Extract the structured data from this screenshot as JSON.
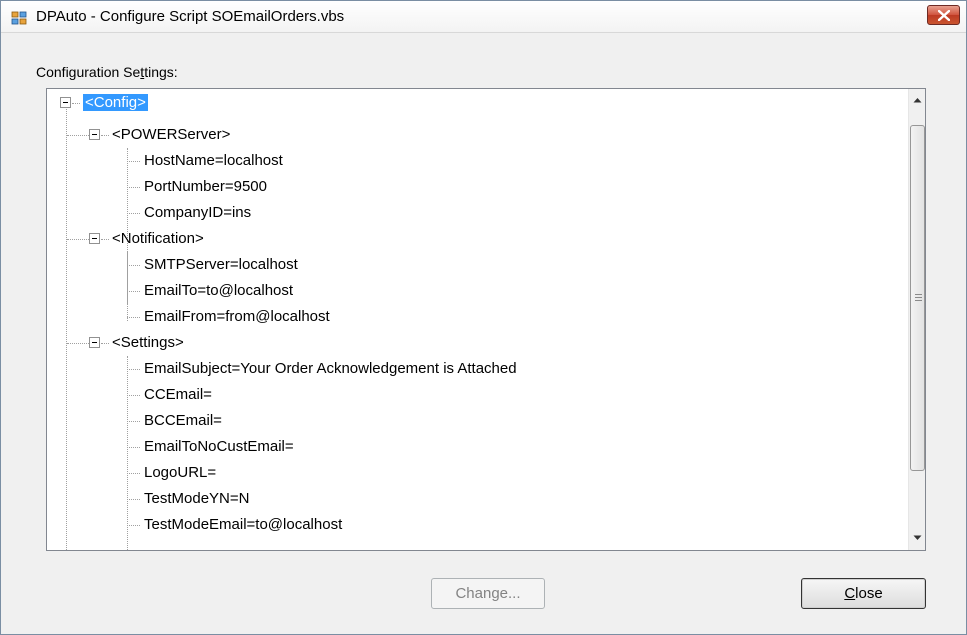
{
  "window": {
    "title": "DPAuto - Configure Script SOEmailOrders.vbs"
  },
  "config_section": {
    "label_pre": "Configuration Se",
    "label_mnemonic": "t",
    "label_post": "tings:"
  },
  "tree": {
    "root": "<Config>",
    "groups": [
      {
        "label": "<POWERServer>",
        "items": [
          "HostName=localhost",
          "PortNumber=9500",
          "CompanyID=ins"
        ]
      },
      {
        "label": "<Notification>",
        "items": [
          "SMTPServer=localhost",
          "EmailTo=to@localhost",
          "EmailFrom=from@localhost"
        ]
      },
      {
        "label": "<Settings>",
        "items": [
          "EmailSubject=Your Order Acknowledgement is Attached",
          "CCEmail=",
          "BCCEmail=",
          "EmailToNoCustEmail=",
          "LogoURL=",
          "TestModeYN=N",
          "TestModeEmail=to@localhost"
        ]
      }
    ]
  },
  "buttons": {
    "change_pre": "Chan",
    "change_mnemonic": "g",
    "change_post": "e...",
    "close_mnemonic": "C",
    "close_post": "lose"
  },
  "icons": {
    "app": "application-window-icon",
    "close": "close-x-icon",
    "scroll_up": "scroll-up-arrow-icon",
    "scroll_down": "scroll-down-arrow-icon"
  },
  "colors": {
    "selection": "#3399ff",
    "close_button": "#c9452f"
  }
}
